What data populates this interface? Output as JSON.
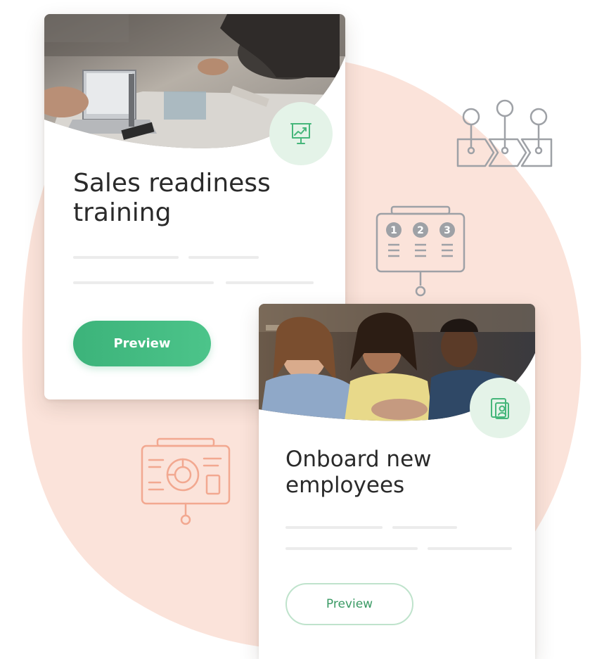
{
  "colors": {
    "blob": "#fbe3da",
    "accent_green": "#3cb37a",
    "badge_bg": "#e4f3e8",
    "icon_gray": "#9ea1a6",
    "icon_salmon": "#f2a890",
    "title_text": "#2a2a2a"
  },
  "cards": [
    {
      "title": "Sales readiness training",
      "badge_icon": "presentation-chart-icon",
      "photo": "meeting-laptops-photo",
      "button_label": "Preview",
      "button_style": "filled"
    },
    {
      "title": "Onboard new employees",
      "badge_icon": "id-badge-icon",
      "photo": "coworkers-smiling-photo",
      "button_label": "Preview",
      "button_style": "outline"
    }
  ],
  "decorations": {
    "steps_labels": [
      "1",
      "2",
      "3"
    ],
    "icons": [
      "process-flow-icon",
      "numbered-steps-board-icon",
      "analytics-board-icon"
    ]
  }
}
